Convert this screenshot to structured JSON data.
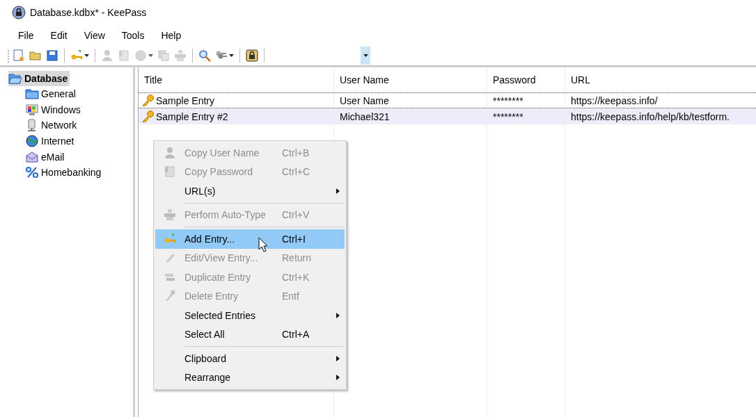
{
  "window": {
    "title": "Database.kdbx* - KeePass"
  },
  "menu_bar": [
    "File",
    "Edit",
    "View",
    "Tools",
    "Help"
  ],
  "toolbar": [
    {
      "kind": "new",
      "disabled": false,
      "dropdown": false
    },
    {
      "kind": "open",
      "disabled": false,
      "dropdown": false
    },
    {
      "kind": "save",
      "disabled": false,
      "dropdown": false
    },
    {
      "kind": "sep"
    },
    {
      "kind": "add",
      "disabled": false,
      "dropdown": true
    },
    {
      "kind": "sep"
    },
    {
      "kind": "user",
      "disabled": true,
      "dropdown": false
    },
    {
      "kind": "password",
      "disabled": true,
      "dropdown": false
    },
    {
      "kind": "url",
      "disabled": true,
      "dropdown": true
    },
    {
      "kind": "copy",
      "disabled": true,
      "dropdown": false
    },
    {
      "kind": "autotype",
      "disabled": true,
      "dropdown": false
    },
    {
      "kind": "sep"
    },
    {
      "kind": "find",
      "disabled": false,
      "dropdown": false
    },
    {
      "kind": "keys",
      "disabled": false,
      "dropdown": true
    },
    {
      "kind": "sep"
    },
    {
      "kind": "lock",
      "disabled": false,
      "dropdown": false
    },
    {
      "kind": "sep"
    }
  ],
  "tree": [
    {
      "label": "Database",
      "selected": true,
      "children": [
        {
          "label": "General",
          "selected": false
        },
        {
          "label": "Windows",
          "selected": false
        },
        {
          "label": "Network",
          "selected": false
        },
        {
          "label": "Internet",
          "selected": false
        },
        {
          "label": "eMail",
          "selected": false
        },
        {
          "label": "Homebanking",
          "selected": false
        }
      ]
    }
  ],
  "table": {
    "columns": [
      "Title",
      "User Name",
      "Password",
      "URL"
    ],
    "rows": [
      {
        "cells": [
          "Sample Entry",
          "User Name",
          "********",
          "https://keepass.info/"
        ],
        "selected": false,
        "focused": true
      },
      {
        "cells": [
          "Sample Entry #2",
          "Michael321",
          "********",
          "https://keepass.info/help/kb/testform."
        ],
        "selected": true,
        "focused": false
      }
    ]
  },
  "context_menu": [
    {
      "kind": "item",
      "label": "Copy User Name",
      "shortcut": "Ctrl+B",
      "disabled": true,
      "submenu": false,
      "selected": false
    },
    {
      "kind": "item",
      "label": "Copy Password",
      "shortcut": "Ctrl+C",
      "disabled": true,
      "submenu": false,
      "selected": false
    },
    {
      "kind": "item",
      "label": "URL(s)",
      "disabled": false,
      "submenu": true,
      "selected": false
    },
    {
      "kind": "separator"
    },
    {
      "kind": "item",
      "label": "Perform Auto-Type",
      "shortcut": "Ctrl+V",
      "disabled": true,
      "submenu": false,
      "selected": false
    },
    {
      "kind": "separator"
    },
    {
      "kind": "item",
      "label": "Add Entry...",
      "shortcut": "Ctrl+I",
      "disabled": false,
      "submenu": false,
      "selected": true
    },
    {
      "kind": "item",
      "label": "Edit/View Entry...",
      "shortcut": "Return",
      "disabled": true,
      "submenu": false,
      "selected": false
    },
    {
      "kind": "item",
      "label": "Duplicate Entry",
      "shortcut": "Ctrl+K",
      "disabled": true,
      "submenu": false,
      "selected": false
    },
    {
      "kind": "item",
      "label": "Delete Entry",
      "shortcut": "Entf",
      "disabled": true,
      "submenu": false,
      "selected": false
    },
    {
      "kind": "item",
      "label": "Selected Entries",
      "disabled": false,
      "submenu": true,
      "selected": false
    },
    {
      "kind": "item",
      "label": "Select All",
      "shortcut": "Ctrl+A",
      "disabled": false,
      "submenu": false,
      "selected": false
    },
    {
      "kind": "separator"
    },
    {
      "kind": "item",
      "label": "Clipboard",
      "disabled": false,
      "submenu": true,
      "selected": false
    },
    {
      "kind": "item",
      "label": "Rearrange",
      "disabled": false,
      "submenu": true,
      "selected": false
    }
  ]
}
